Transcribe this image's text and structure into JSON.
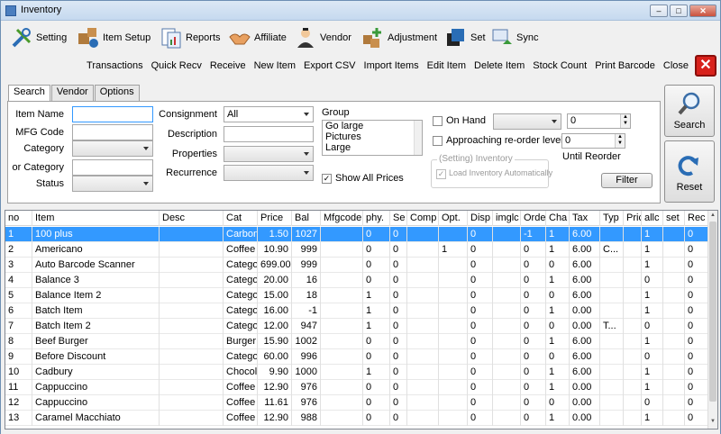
{
  "window": {
    "title": "Inventory"
  },
  "main_toolbar": [
    {
      "label": "Setting",
      "icon": "setting-icon"
    },
    {
      "label": "Item Setup",
      "icon": "item-setup-icon"
    },
    {
      "label": "Reports",
      "icon": "reports-icon"
    },
    {
      "label": "Affiliate",
      "icon": "affiliate-icon"
    },
    {
      "label": "Vendor",
      "icon": "vendor-icon"
    },
    {
      "label": "Adjustment",
      "icon": "adjustment-icon"
    },
    {
      "label": "Set",
      "icon": "set-icon"
    },
    {
      "label": "Sync",
      "icon": "sync-icon"
    }
  ],
  "action_bar": [
    "Transactions",
    "Quick Recv",
    "Receive",
    "New Item",
    "Export CSV",
    "Import Items",
    "Edit Item",
    "Delete Item",
    "Stock Count",
    "Print Barcode",
    "Close"
  ],
  "tabs": [
    "Search",
    "Vendor",
    "Options"
  ],
  "search": {
    "item_name_label": "Item Name",
    "item_name_value": "",
    "mfg_code_label": "MFG Code",
    "mfg_code_value": "",
    "category_label": "Category",
    "category_value": "",
    "or_category_label": "or Category",
    "or_category_value": "",
    "status_label": "Status",
    "status_value": "",
    "consignment_label": "Consignment",
    "consignment_value": "All",
    "description_label": "Description",
    "description_value": "",
    "properties_label": "Properties",
    "properties_value": "",
    "recurrence_label": "Recurrence",
    "recurrence_value": "",
    "group_label": "Group",
    "group_options": [
      "Go large",
      "Pictures",
      "Large"
    ],
    "show_all_prices_label": "Show All Prices",
    "show_all_prices_checked": true,
    "on_hand_label": "On Hand",
    "on_hand_value": "0",
    "approaching_label": "Approaching re-order level",
    "approaching_value": "0",
    "until_reorder_label": "Until Reorder",
    "setting_inventory_title": "(Setting) Inventory",
    "load_inventory_label": "Load Inventory Automatically",
    "filter_button": "Filter",
    "search_button": "Search",
    "reset_button": "Reset"
  },
  "table": {
    "columns": [
      "no",
      "Item",
      "Desc",
      "Cat",
      "Price",
      "Bal",
      "Mfgcode",
      "phy.",
      "Se",
      "Comp",
      "Opt.",
      "Disp",
      "imglc",
      "Orde",
      "Cha",
      "Tax",
      "Typ",
      "Pric",
      "allc",
      "set",
      "Rec"
    ],
    "rows": [
      [
        "1",
        "100 plus",
        "",
        "Carbon",
        "1.50",
        "1027",
        "",
        "0",
        "0",
        "",
        "",
        "0",
        "",
        "-1",
        "1",
        "6.00",
        "",
        "",
        "1",
        "",
        "0"
      ],
      [
        "2",
        "Americano",
        "",
        "Coffee",
        "10.90",
        "999",
        "",
        "0",
        "0",
        "",
        "1",
        "0",
        "",
        "0",
        "1",
        "6.00",
        "C...",
        "",
        "1",
        "",
        "0"
      ],
      [
        "3",
        "Auto Barcode Scanner",
        "",
        "Category",
        "699.00",
        "999",
        "",
        "0",
        "0",
        "",
        "",
        "0",
        "",
        "0",
        "0",
        "6.00",
        "",
        "",
        "1",
        "",
        "0"
      ],
      [
        "4",
        "Balance 3",
        "",
        "Category",
        "20.00",
        "16",
        "",
        "0",
        "0",
        "",
        "",
        "0",
        "",
        "0",
        "1",
        "6.00",
        "",
        "",
        "0",
        "",
        "0"
      ],
      [
        "5",
        "Balance Item 2",
        "",
        "Category",
        "15.00",
        "18",
        "",
        "1",
        "0",
        "",
        "",
        "0",
        "",
        "0",
        "0",
        "6.00",
        "",
        "",
        "1",
        "",
        "0"
      ],
      [
        "6",
        "Batch Item",
        "",
        "Category",
        "16.00",
        "-1",
        "",
        "1",
        "0",
        "",
        "",
        "0",
        "",
        "0",
        "1",
        "0.00",
        "",
        "",
        "1",
        "",
        "0"
      ],
      [
        "7",
        "Batch Item 2",
        "",
        "Category",
        "12.00",
        "947",
        "",
        "1",
        "0",
        "",
        "",
        "0",
        "",
        "0",
        "0",
        "0.00",
        "T...",
        "",
        "0",
        "",
        "0"
      ],
      [
        "8",
        "Beef Burger",
        "",
        "Burger",
        "15.90",
        "1002",
        "",
        "0",
        "0",
        "",
        "",
        "0",
        "",
        "0",
        "1",
        "6.00",
        "",
        "",
        "1",
        "",
        "0"
      ],
      [
        "9",
        "Before Discount",
        "",
        "Category",
        "60.00",
        "996",
        "",
        "0",
        "0",
        "",
        "",
        "0",
        "",
        "0",
        "0",
        "6.00",
        "",
        "",
        "0",
        "",
        "0"
      ],
      [
        "10",
        "Cadbury",
        "",
        "Chocolate",
        "9.90",
        "1000",
        "",
        "1",
        "0",
        "",
        "",
        "0",
        "",
        "0",
        "1",
        "6.00",
        "",
        "",
        "1",
        "",
        "0"
      ],
      [
        "11",
        "Cappuccino",
        "",
        "Coffee",
        "12.90",
        "976",
        "",
        "0",
        "0",
        "",
        "",
        "0",
        "",
        "0",
        "1",
        "0.00",
        "",
        "",
        "1",
        "",
        "0"
      ],
      [
        "12",
        "Cappuccino",
        "",
        "Coffee",
        "11.61",
        "976",
        "",
        "0",
        "0",
        "",
        "",
        "0",
        "",
        "0",
        "0",
        "0.00",
        "",
        "",
        "0",
        "",
        "0"
      ],
      [
        "13",
        "Caramel Macchiato",
        "",
        "Coffee",
        "12.90",
        "988",
        "",
        "0",
        "0",
        "",
        "",
        "0",
        "",
        "0",
        "1",
        "0.00",
        "",
        "",
        "1",
        "",
        "0"
      ]
    ],
    "selected_row": 0
  }
}
